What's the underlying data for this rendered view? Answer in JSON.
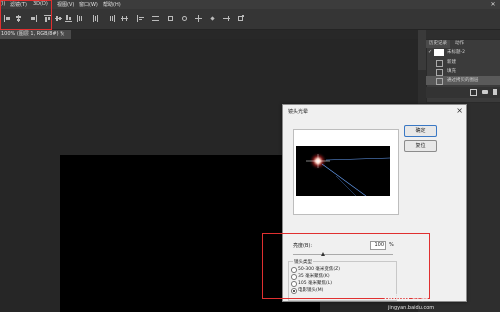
{
  "menubar": {
    "items": [
      "滤镜(T)",
      "3D(D)",
      "视图(V)",
      "窗口(W)",
      "帮助(H)"
    ],
    "left_fragment": "(I)"
  },
  "document_tab": {
    "title": "100% (图层 1, RGB/8#) *",
    "close": "×"
  },
  "right_panel": {
    "tabs": [
      "历史记录",
      "动作"
    ],
    "snapshot": "未标题-2",
    "history_items": [
      "新建",
      "填充",
      "通过拷贝的图层"
    ]
  },
  "dialog": {
    "title": "镜头光晕",
    "close": "×",
    "ok_label": "确定",
    "cancel_label": "复位",
    "brightness_label": "亮度(B):",
    "brightness_value": "100",
    "brightness_unit": "%",
    "brightness_fraction": 0.3,
    "lens_type_label": "镜头类型",
    "lens_options": [
      {
        "label": "50-300 毫米变焦(Z)",
        "selected": false
      },
      {
        "label": "35 毫米聚焦(K)",
        "selected": false
      },
      {
        "label": "105 毫米聚焦(L)",
        "selected": false
      },
      {
        "label": "电影镜头(M)",
        "selected": true
      }
    ]
  },
  "watermark": {
    "text": "Baidu 经验",
    "url": "jingyan.baidu.com"
  },
  "colors": {
    "accent_highlight": "#e03030",
    "canvas": "#000000",
    "workspace": "#282828"
  }
}
